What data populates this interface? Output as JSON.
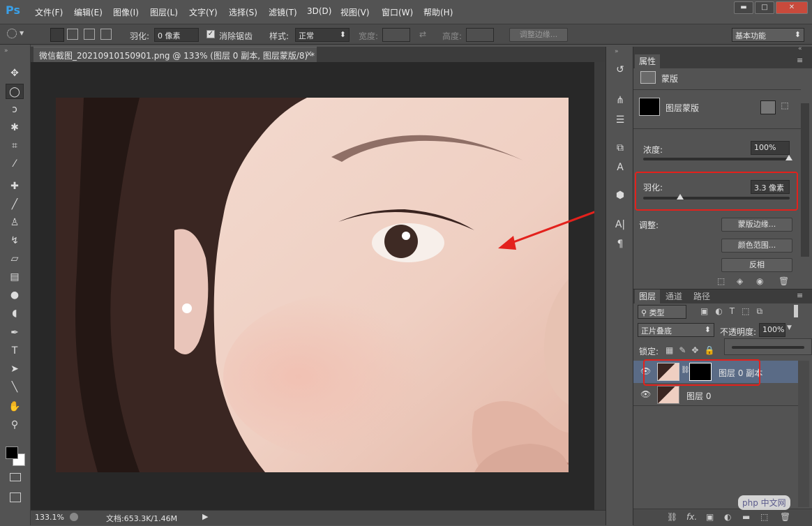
{
  "app": {
    "logo": "Ps"
  },
  "menu": [
    "文件(F)",
    "编辑(E)",
    "图像(I)",
    "图层(L)",
    "文字(Y)",
    "选择(S)",
    "滤镜(T)",
    "3D(D)",
    "视图(V)",
    "窗口(W)",
    "帮助(H)"
  ],
  "window_controls": {
    "minimize": "▬",
    "restore": "□",
    "close": "✕"
  },
  "options": {
    "feather_label": "羽化:",
    "feather_value": "0 像素",
    "antialias_label": "消除锯齿",
    "style_label": "样式:",
    "style_value": "正常",
    "width_label": "宽度:",
    "height_label": "高度:",
    "refine_edge": "调整边缘...",
    "workspace": "基本功能"
  },
  "document": {
    "tab_title": "微信截图_20210910150901.png @ 133% (图层 0 副本, 图层蒙版/8) *",
    "tab_close": "×",
    "zoom": "133.1%",
    "doc_info": "文档:653.3K/1.46M"
  },
  "properties": {
    "tab": "属性",
    "section": "蒙版",
    "mask_name": "图层蒙版",
    "density_label": "浓度:",
    "density_value": "100%",
    "feather_label": "羽化:",
    "feather_value": "3.3 像素",
    "feather_fraction": 0.25,
    "adjust_label": "调整:",
    "mask_edge": "蒙版边缘...",
    "color_range": "颜色范围...",
    "invert": "反相"
  },
  "layers": {
    "tabs": [
      "图层",
      "通道",
      "路径"
    ],
    "filter_kind": "类型",
    "blend_mode": "正片叠底",
    "opacity_label": "不透明度:",
    "opacity_value": "100%",
    "lock_label": "锁定:",
    "rows": [
      {
        "name": "图层 0 副本",
        "selected": true
      },
      {
        "name": "图层 0",
        "selected": false
      }
    ],
    "footer_fx": "fx."
  },
  "watermark": "php 中文网",
  "colors": {
    "accent_red": "#e3211c",
    "selection": "#5a6b86",
    "panel": "#535353"
  }
}
